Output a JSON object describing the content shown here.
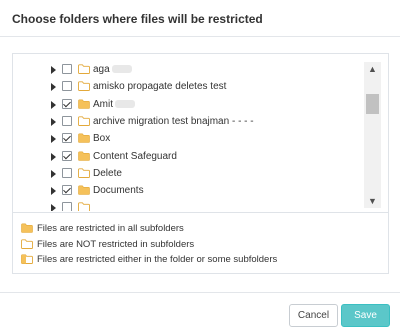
{
  "dialog": {
    "title": "Choose folders where files will be restricted"
  },
  "tree": {
    "items": [
      {
        "label": "aga",
        "checked": false,
        "folder": "outline",
        "redacted": true
      },
      {
        "label": "amisko propagate deletes test",
        "checked": false,
        "folder": "outline",
        "redacted": false
      },
      {
        "label": "Amit",
        "checked": true,
        "folder": "filled",
        "redacted": true
      },
      {
        "label": "archive migration test bnajman - - - -",
        "checked": false,
        "folder": "outline",
        "redacted": false
      },
      {
        "label": "Box",
        "checked": true,
        "folder": "filled",
        "redacted": false
      },
      {
        "label": "Content Safeguard",
        "checked": true,
        "folder": "filled",
        "redacted": false
      },
      {
        "label": "Delete",
        "checked": false,
        "folder": "outline",
        "redacted": false
      },
      {
        "label": "Documents",
        "checked": true,
        "folder": "filled",
        "redacted": false
      },
      {
        "label": "",
        "checked": false,
        "folder": "outline",
        "redacted": false
      }
    ]
  },
  "legend": [
    {
      "text": "Files are restricted in all subfolders",
      "icon": "filled-folder-icon"
    },
    {
      "text": "Files are NOT restricted in subfolders",
      "icon": "outline-folder-icon"
    },
    {
      "text": "Files are restricted either in the folder or some subfolders",
      "icon": "partial-folder-icon"
    }
  ],
  "buttons": {
    "cancel": "Cancel",
    "save": "Save"
  },
  "colors": {
    "folder_fill": "#f5c15a",
    "folder_outline": "#e3a93a",
    "save_bg": "#5bc7c9",
    "text": "#333333"
  }
}
